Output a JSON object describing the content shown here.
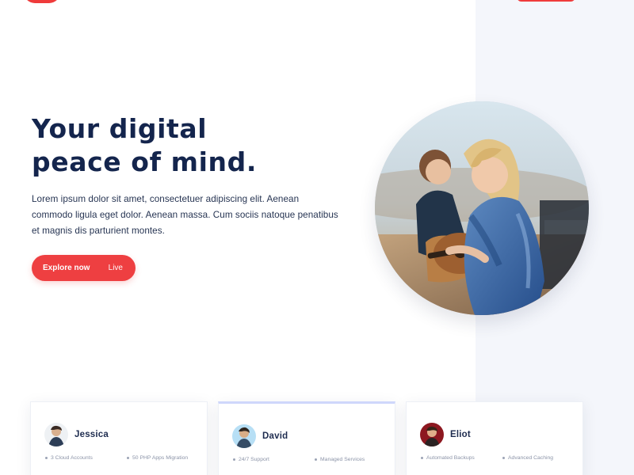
{
  "hero": {
    "title_line_1": "Your digital",
    "title_line_2": "peace of mind.",
    "description": "Lorem ipsum dolor sit amet, consectetuer adipiscing elit. Aenean commodo ligula eget dolor. Aenean massa. Cum sociis natoque penatibus et magnis dis parturient montes.",
    "button_primary": "Explore now",
    "button_secondary": "Live"
  },
  "cards": [
    {
      "name": "Jessica",
      "items": [
        "3 Cloud Accounts",
        "50 PHP Apps Migration"
      ]
    },
    {
      "name": "David",
      "items": [
        "24/7 Support",
        "Managed Services"
      ]
    },
    {
      "name": "Eliot",
      "items": [
        "Automated Backups",
        "Advanced Caching"
      ]
    }
  ],
  "colors": {
    "accent": "#ee3f41",
    "heading": "#14254d",
    "text": "#273553",
    "panel": "#f4f6fb"
  }
}
